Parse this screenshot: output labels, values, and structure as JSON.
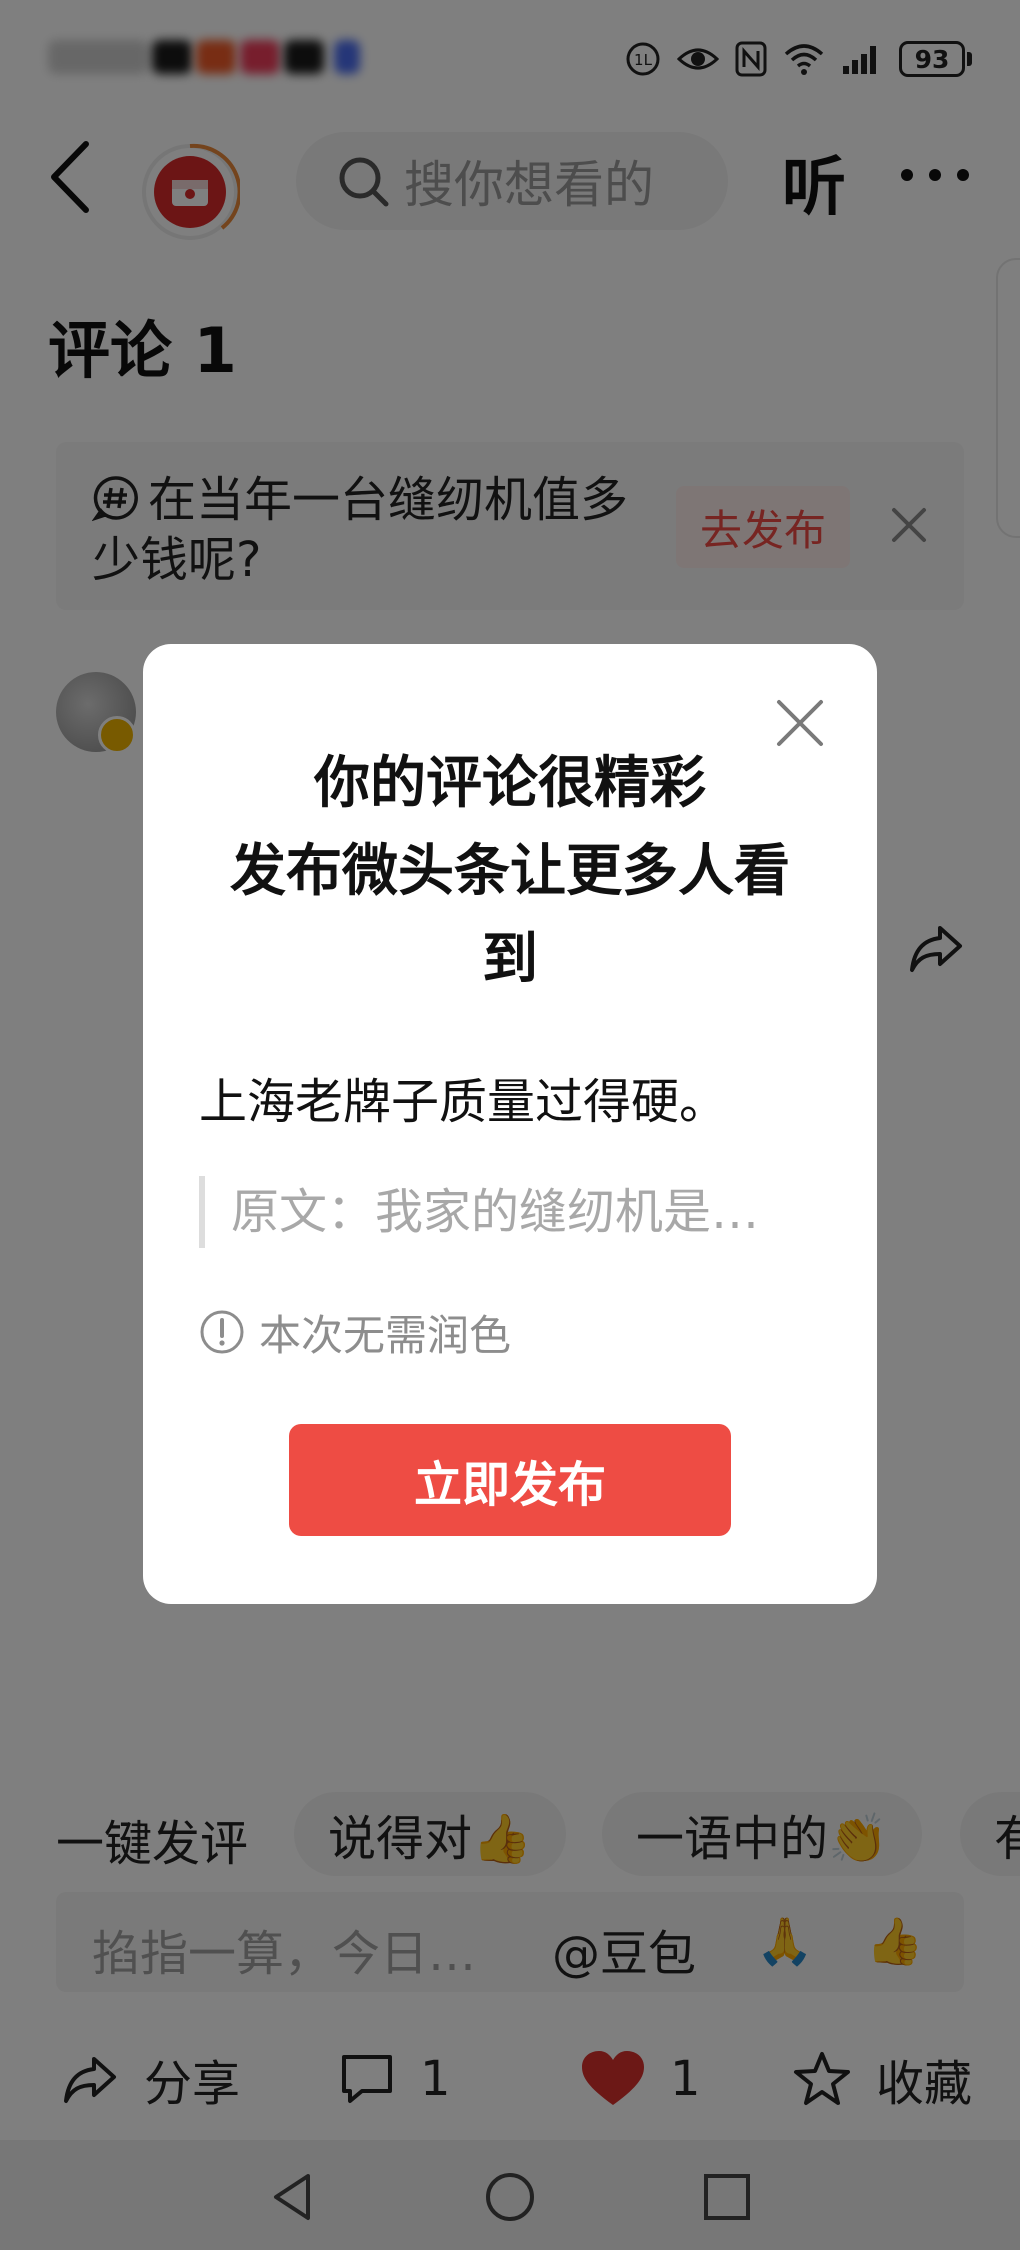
{
  "status_bar": {
    "battery": "93"
  },
  "header": {
    "search_placeholder": "搜你想看的",
    "listen_label": "听"
  },
  "comments": {
    "title": "评论 1",
    "topic_prompt": "在当年一台缝纫机值多少钱呢?",
    "topic_publish_label": "去发布"
  },
  "quick_reply": {
    "label": "一键发评",
    "chips": [
      "说得对👍",
      "一语中的👏",
      "有"
    ]
  },
  "comment_input": {
    "placeholder": "掐指一算，今日…",
    "mention": "@豆包",
    "emojis": [
      "🙏",
      "👍"
    ]
  },
  "action_bar": {
    "share_label": "分享",
    "comment_count": "1",
    "like_count": "1",
    "favorite_label": "收藏"
  },
  "modal": {
    "title": "你的评论很精彩\n发布微头条让更多人看到",
    "title_line1": "你的评论很精彩",
    "title_line2": "发布微头条让更多人看",
    "title_line3": "到",
    "comment_text": "上海老牌子质量过得硬。",
    "original_quote": "原文：我家的缝纫机是…",
    "hint": "本次无需润色",
    "publish_label": "立即发布"
  },
  "colors": {
    "accent_red": "#ee4c44",
    "overlay": "rgba(0,0,0,0.5)"
  }
}
